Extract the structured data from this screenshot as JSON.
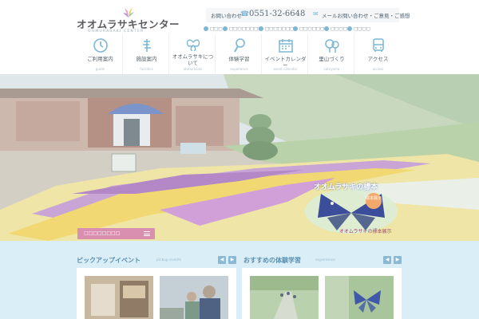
{
  "site": {
    "logo_text": "オオムラサキセンター",
    "logo_sub": "OHMURASAKI CENTER"
  },
  "contact": {
    "label": "お問い合わせ",
    "phone": "0551-32-6648",
    "mail_label": "メールお問い合わせ・ご意見・ご感想"
  },
  "sub_links": [
    "□□□",
    "□□□□□□□□",
    "□□□□□□□",
    "□□□□□□",
    "□□□□",
    "□□□□"
  ],
  "nav": [
    {
      "label": "ご利用案内",
      "sub": "guide",
      "icon": "clock-icon"
    },
    {
      "label": "施設案内",
      "sub": "facilities",
      "icon": "signpost-icon"
    },
    {
      "label": "オオムラサキについて",
      "sub": "ohmurasaki",
      "icon": "butterfly-icon"
    },
    {
      "label": "体験学習",
      "sub": "experience",
      "icon": "magnifier-icon"
    },
    {
      "label": "イベントカレンダー",
      "sub": "event calendar",
      "icon": "calendar-icon"
    },
    {
      "label": "里山づくり",
      "sub": "satoyama",
      "icon": "tree-icon"
    },
    {
      "label": "アクセス",
      "sub": "access",
      "icon": "bus-icon"
    }
  ],
  "hero": {
    "button_label": "□□□□□□□□",
    "callout_title": "オオムラサキの標本",
    "callout_badge": "標本展示",
    "callout_caption": "オオムラサキの標本展示"
  },
  "sections": {
    "pickup": {
      "title": "ピックアップイベント",
      "sub": "pickup events"
    },
    "recommended": {
      "title": "おすすめの体験学習",
      "sub": "experience"
    }
  },
  "colors": {
    "accent": "#7cb7d6",
    "pink": "#d98fb0",
    "lower_bg": "#d9eef6"
  }
}
